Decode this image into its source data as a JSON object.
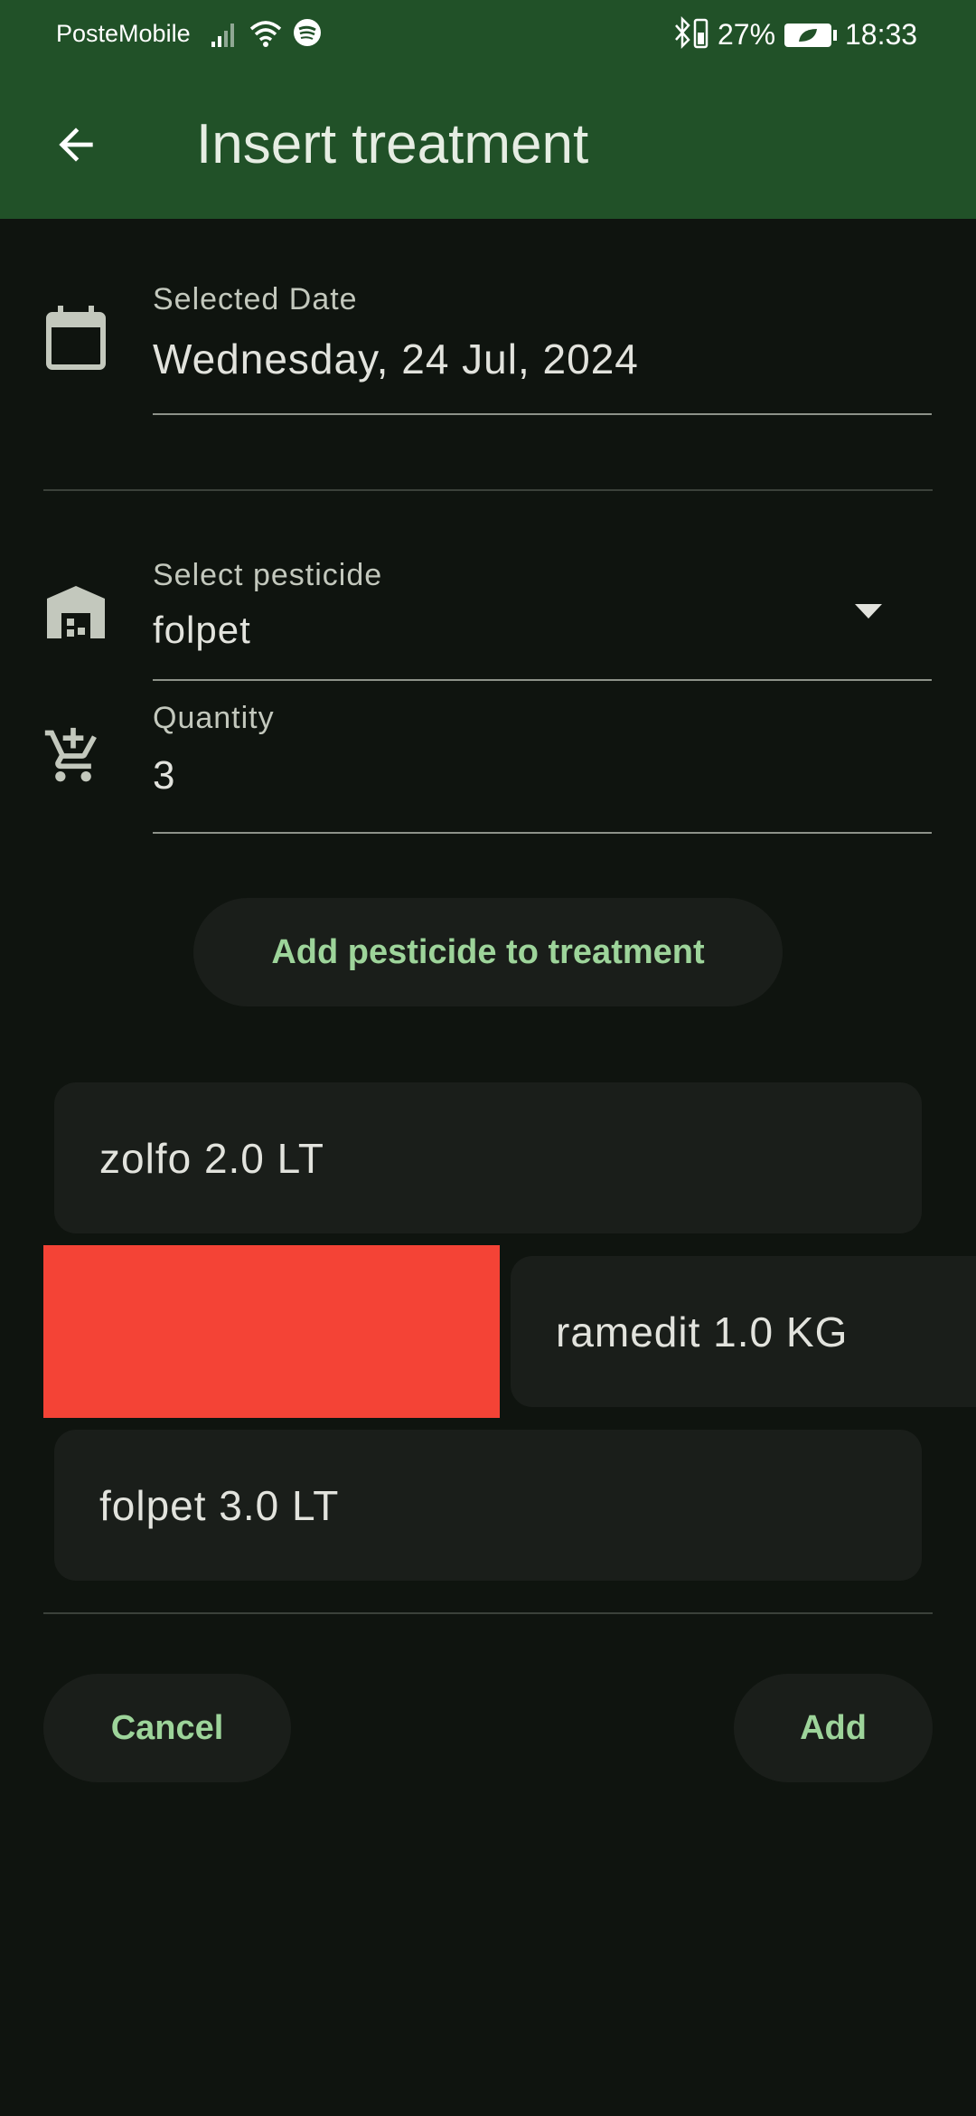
{
  "status_bar": {
    "carrier": "PosteMobile",
    "battery": "27%",
    "time": "18:33"
  },
  "app_bar": {
    "title": "Insert treatment",
    "back_icon": "arrow-back-icon"
  },
  "date_field": {
    "icon": "calendar-icon",
    "label": "Selected Date",
    "value": "Wednesday, 24 Jul, 2024"
  },
  "pesticide_field": {
    "icon": "warehouse-icon",
    "label": "Select pesticide",
    "value": "folpet"
  },
  "quantity_field": {
    "icon": "add-shopping-cart-icon",
    "label": "Quantity",
    "value": "3"
  },
  "add_pesticide_button": "Add pesticide to treatment",
  "pesticide_list": [
    {
      "text": "zolfo 2.0 LT"
    },
    {
      "text": "ramedit 1.0 KG"
    },
    {
      "text": "folpet 3.0 LT"
    }
  ],
  "swipe_background_color": "#f44336",
  "footer": {
    "cancel": "Cancel",
    "add": "Add"
  },
  "colors": {
    "app_bar": "#215128",
    "background": "#0f140f",
    "accent_text": "#9dd49a"
  }
}
